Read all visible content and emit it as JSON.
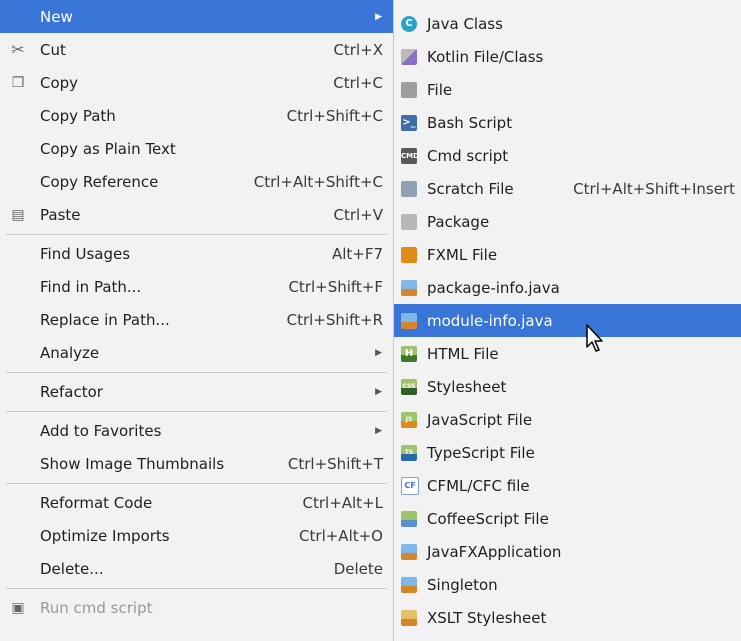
{
  "context_menu": {
    "items": [
      {
        "label": "New",
        "shortcut": "",
        "submenu": true
      },
      {
        "label": "Cut",
        "shortcut": "Ctrl+X",
        "icon": "cut-icon"
      },
      {
        "label": "Copy",
        "shortcut": "Ctrl+C",
        "icon": "copy-icon"
      },
      {
        "label": "Copy Path",
        "shortcut": "Ctrl+Shift+C"
      },
      {
        "label": "Copy as Plain Text",
        "shortcut": ""
      },
      {
        "label": "Copy Reference",
        "shortcut": "Ctrl+Alt+Shift+C"
      },
      {
        "label": "Paste",
        "shortcut": "Ctrl+V",
        "icon": "paste-icon"
      },
      {
        "label": "Find Usages",
        "shortcut": "Alt+F7"
      },
      {
        "label": "Find in Path...",
        "shortcut": "Ctrl+Shift+F"
      },
      {
        "label": "Replace in Path...",
        "shortcut": "Ctrl+Shift+R"
      },
      {
        "label": "Analyze",
        "shortcut": "",
        "submenu": true
      },
      {
        "label": "Refactor",
        "shortcut": "",
        "submenu": true
      },
      {
        "label": "Add to Favorites",
        "shortcut": "",
        "submenu": true
      },
      {
        "label": "Show Image Thumbnails",
        "shortcut": "Ctrl+Shift+T"
      },
      {
        "label": "Reformat Code",
        "shortcut": "Ctrl+Alt+L"
      },
      {
        "label": "Optimize Imports",
        "shortcut": "Ctrl+Alt+O"
      },
      {
        "label": "Delete...",
        "shortcut": "Delete"
      },
      {
        "label": "Run cmd script",
        "shortcut": "",
        "disabled": true,
        "icon": "run-script-icon"
      }
    ]
  },
  "new_submenu": {
    "items": [
      {
        "label": "Java Class",
        "icon": "java-class-icon",
        "glyph": "C"
      },
      {
        "label": "Kotlin File/Class",
        "icon": "kotlin-file-icon",
        "glyph": ""
      },
      {
        "label": "File",
        "icon": "file-icon",
        "glyph": ""
      },
      {
        "label": "Bash Script",
        "icon": "bash-script-icon",
        "glyph": ">_"
      },
      {
        "label": "Cmd script",
        "icon": "cmd-script-icon",
        "glyph": "CMD"
      },
      {
        "label": "Scratch File",
        "shortcut": "Ctrl+Alt+Shift+Insert",
        "icon": "scratch-file-icon",
        "glyph": ""
      },
      {
        "label": "Package",
        "icon": "package-icon",
        "glyph": ""
      },
      {
        "label": "FXML File",
        "icon": "fxml-file-icon",
        "glyph": ""
      },
      {
        "label": "package-info.java",
        "icon": "package-info-icon",
        "glyph": ""
      },
      {
        "label": "module-info.java",
        "icon": "module-info-icon",
        "glyph": "",
        "selected": true
      },
      {
        "label": "HTML File",
        "icon": "html-file-icon",
        "glyph": "H"
      },
      {
        "label": "Stylesheet",
        "icon": "stylesheet-icon",
        "glyph": "CSS"
      },
      {
        "label": "JavaScript File",
        "icon": "javascript-file-icon",
        "glyph": "JS"
      },
      {
        "label": "TypeScript File",
        "icon": "typescript-file-icon",
        "glyph": "TS"
      },
      {
        "label": "CFML/CFC file",
        "icon": "cfml-file-icon",
        "glyph": "CF"
      },
      {
        "label": "CoffeeScript File",
        "icon": "coffeescript-file-icon",
        "glyph": ""
      },
      {
        "label": "JavaFXApplication",
        "icon": "javafx-app-icon",
        "glyph": ""
      },
      {
        "label": "Singleton",
        "icon": "singleton-icon",
        "glyph": ""
      },
      {
        "label": "XSLT Stylesheet",
        "icon": "xslt-stylesheet-icon",
        "glyph": ""
      }
    ]
  },
  "colors": {
    "selection": "#3875d7",
    "menu_bg": "#f2f2f2",
    "disabled_text": "#9a9a9a"
  }
}
